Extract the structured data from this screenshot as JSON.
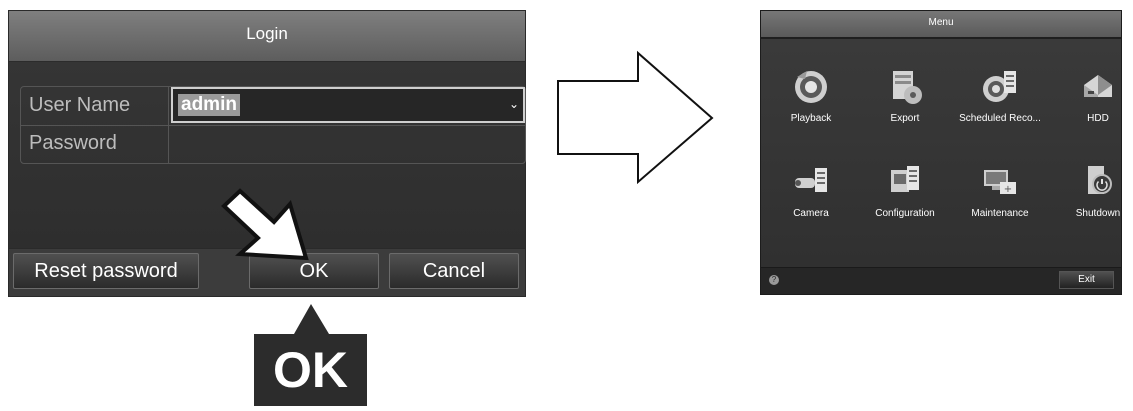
{
  "login": {
    "title": "Login",
    "username_label": "User Name",
    "username_value": "admin",
    "password_label": "Password",
    "password_value": "",
    "reset_password_label": "Reset password",
    "ok_label": "OK",
    "cancel_label": "Cancel"
  },
  "callout": {
    "label": "OK"
  },
  "menu": {
    "title": "Menu",
    "items": [
      {
        "label": "Playback",
        "icon": "playback-icon"
      },
      {
        "label": "Export",
        "icon": "export-icon"
      },
      {
        "label": "Scheduled Reco...",
        "icon": "scheduled-recording-icon"
      },
      {
        "label": "HDD",
        "icon": "hdd-icon"
      },
      {
        "label": "Camera",
        "icon": "camera-icon"
      },
      {
        "label": "Configuration",
        "icon": "configuration-icon"
      },
      {
        "label": "Maintenance",
        "icon": "maintenance-icon"
      },
      {
        "label": "Shutdown",
        "icon": "shutdown-icon"
      }
    ],
    "exit_label": "Exit"
  },
  "colors": {
    "dialog_bg": "#3a3a3a",
    "header_gradient_top": "#7f7f7f",
    "field_highlight": "#9a9a9a",
    "callout_bg": "#2c2c2c"
  }
}
